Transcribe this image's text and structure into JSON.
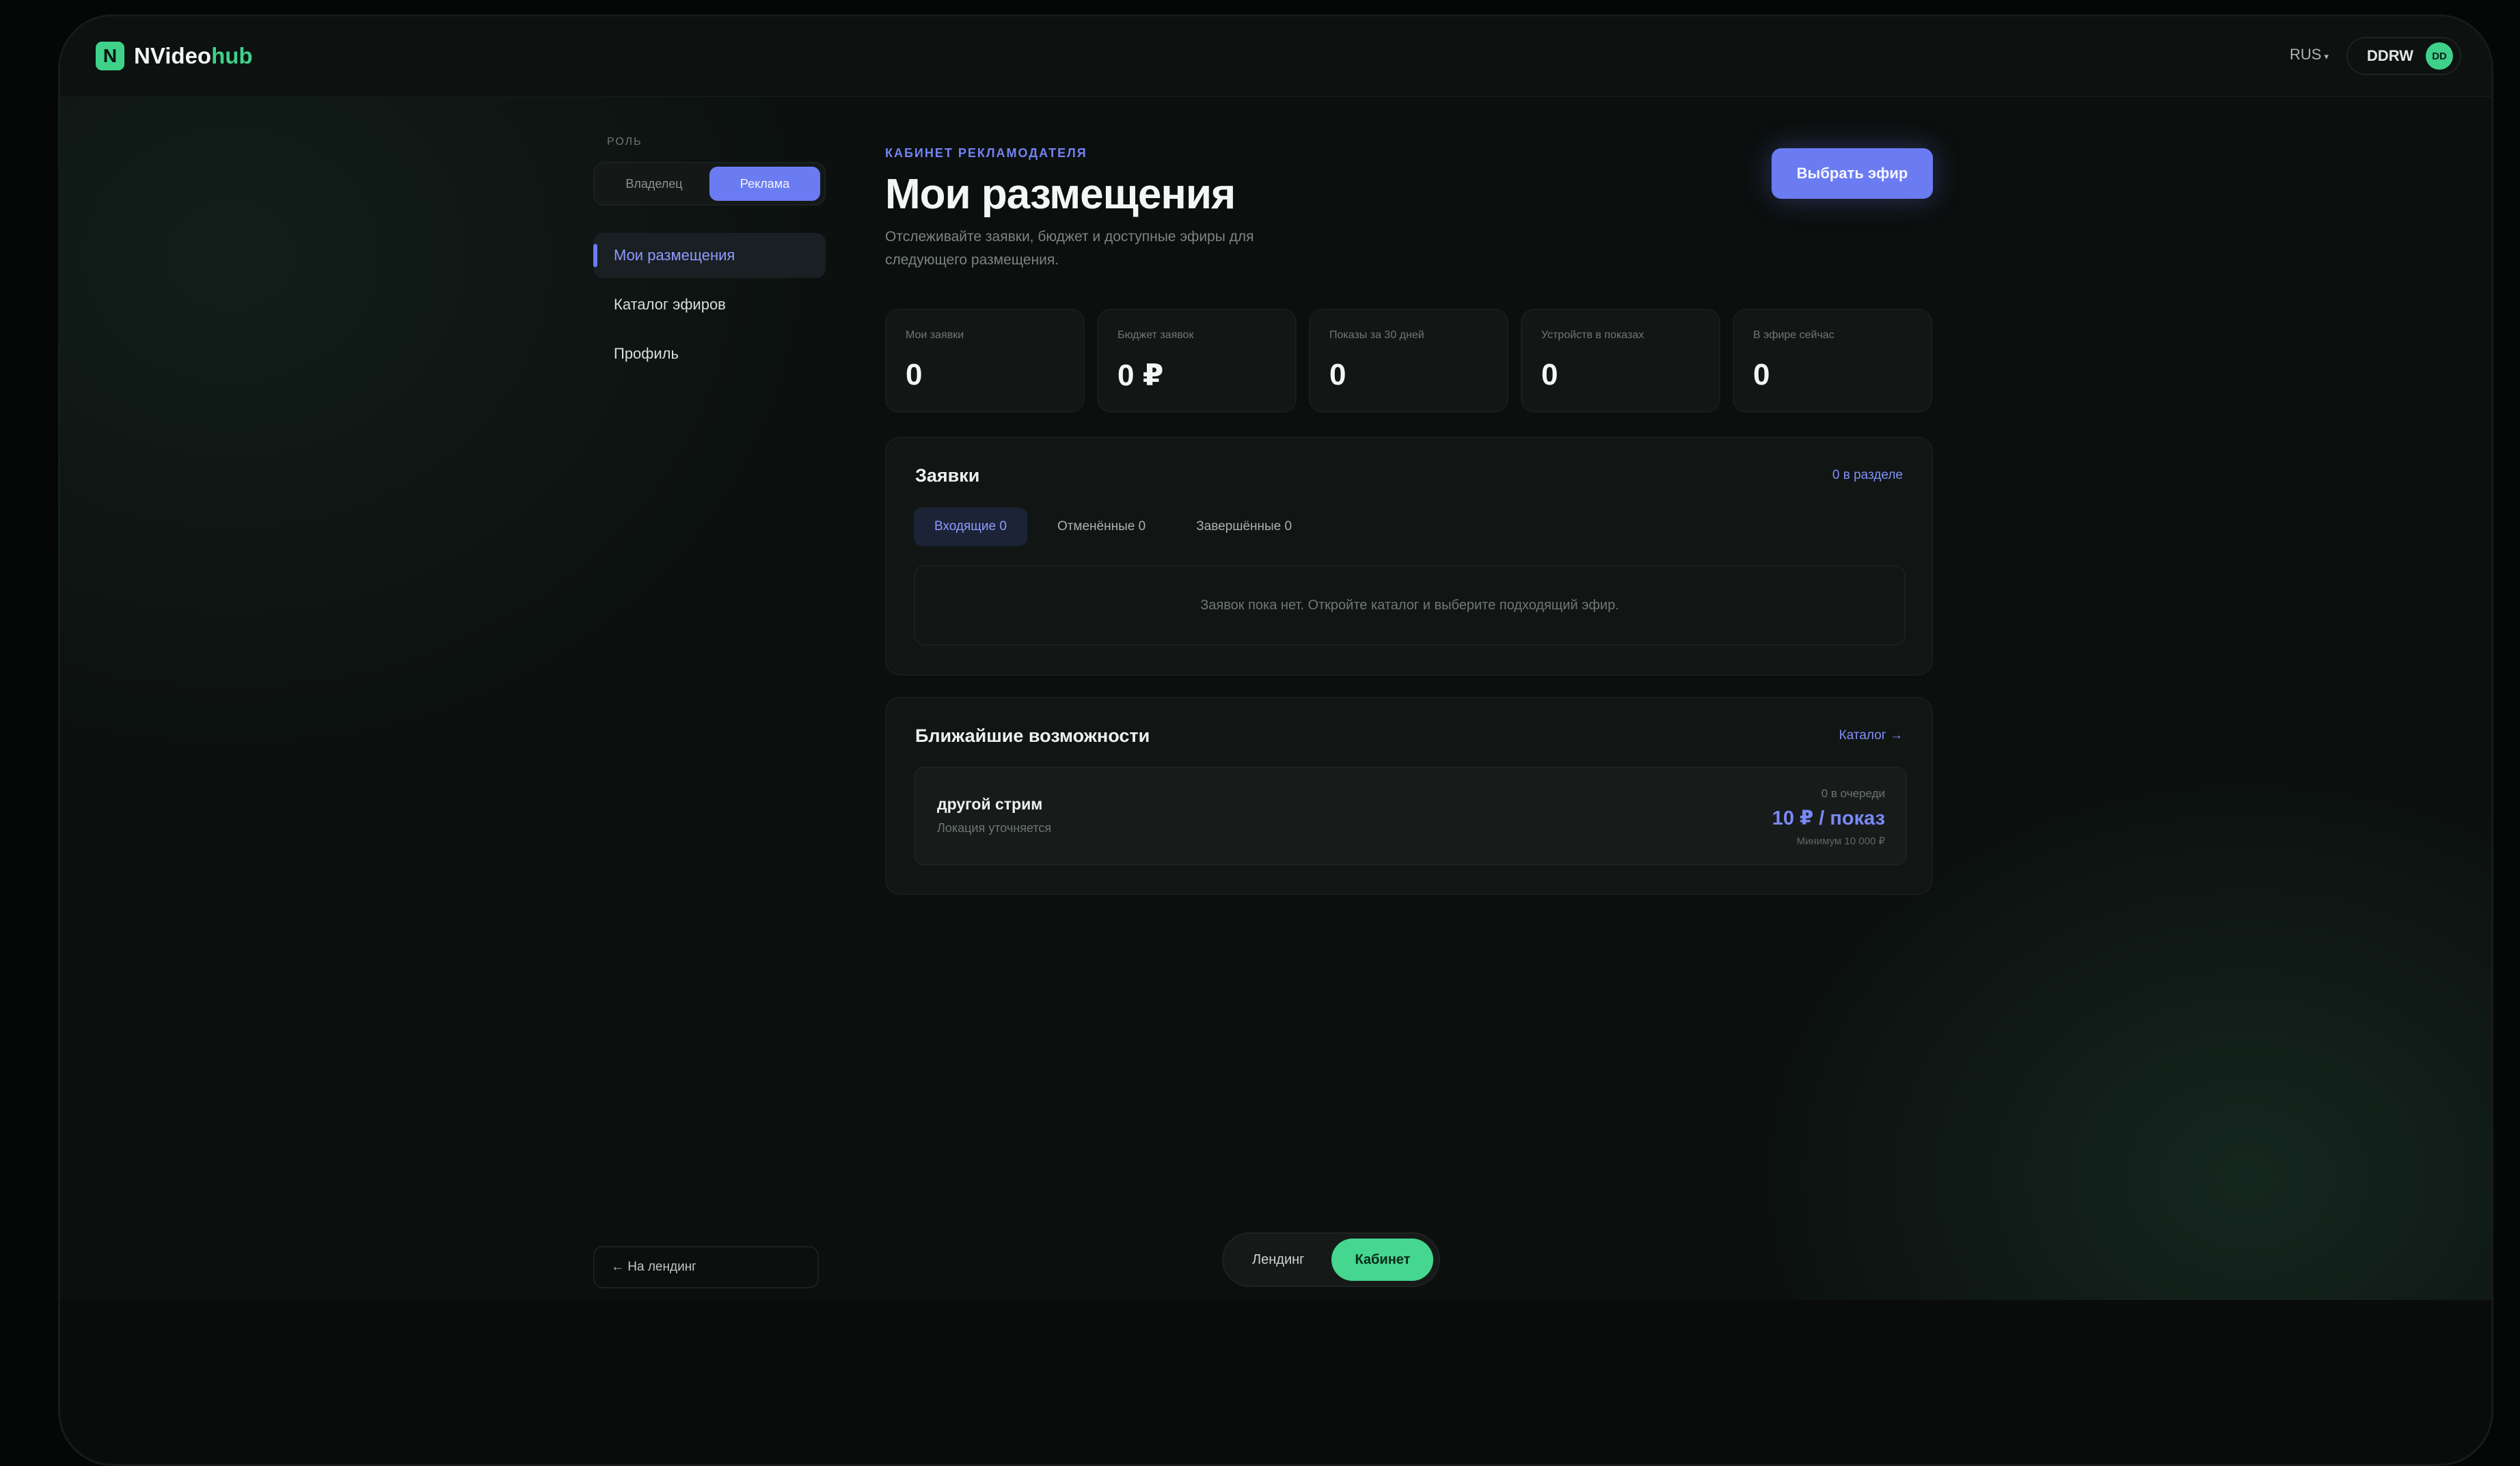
{
  "app": {
    "logo_mark": "N",
    "logo_text_a": "NVideo",
    "logo_text_b": "hub"
  },
  "topbar": {
    "language": "RUS",
    "user_name": "DDRW",
    "avatar_initials": "DD"
  },
  "sidebar": {
    "role_label": "РОЛЬ",
    "roles": [
      {
        "label": "Владелец",
        "active": false
      },
      {
        "label": "Реклама",
        "active": true
      }
    ],
    "nav": [
      {
        "label": "Мои размещения",
        "active": true
      },
      {
        "label": "Каталог эфиров",
        "active": false
      },
      {
        "label": "Профиль",
        "active": false
      }
    ],
    "back_link": "← На лендинг"
  },
  "header": {
    "eyebrow": "КАБИНЕТ РЕКЛАМОДАТЕЛЯ",
    "title": "Мои размещения",
    "description": "Отслеживайте заявки, бюджет и доступные эфиры для следующего размещения.",
    "cta_label": "Выбрать эфир"
  },
  "stats": [
    {
      "label": "Мои заявки",
      "value": "0"
    },
    {
      "label": "Бюджет заявок",
      "value": "0 ₽"
    },
    {
      "label": "Показы за 30 дней",
      "value": "0"
    },
    {
      "label": "Устройств в показах",
      "value": "0"
    },
    {
      "label": "В эфире сейчас",
      "value": "0"
    }
  ],
  "requests": {
    "title": "Заявки",
    "count_link": "0 в разделе",
    "tabs": [
      {
        "label": "Входящие 0",
        "active": true
      },
      {
        "label": "Отменённые 0",
        "active": false
      },
      {
        "label": "Завершённые 0",
        "active": false
      }
    ],
    "empty_text": "Заявок пока нет. Откройте каталог и выберите подходящий эфир."
  },
  "opportunities": {
    "title": "Ближайшие возможности",
    "catalog_link": "Каталог →",
    "items": [
      {
        "name": "другой стрим",
        "location": "Локация уточняется",
        "queue": "0 в очереди",
        "price": "10 ₽ / показ",
        "minimum": "Минимум 10 000 ₽"
      }
    ]
  },
  "switcher": {
    "landing": "Лендинг",
    "cabinet": "Кабинет"
  },
  "colors": {
    "accent": "#6b7cf2",
    "brand_green": "#3fd18a",
    "background": "#0b0f0e"
  }
}
